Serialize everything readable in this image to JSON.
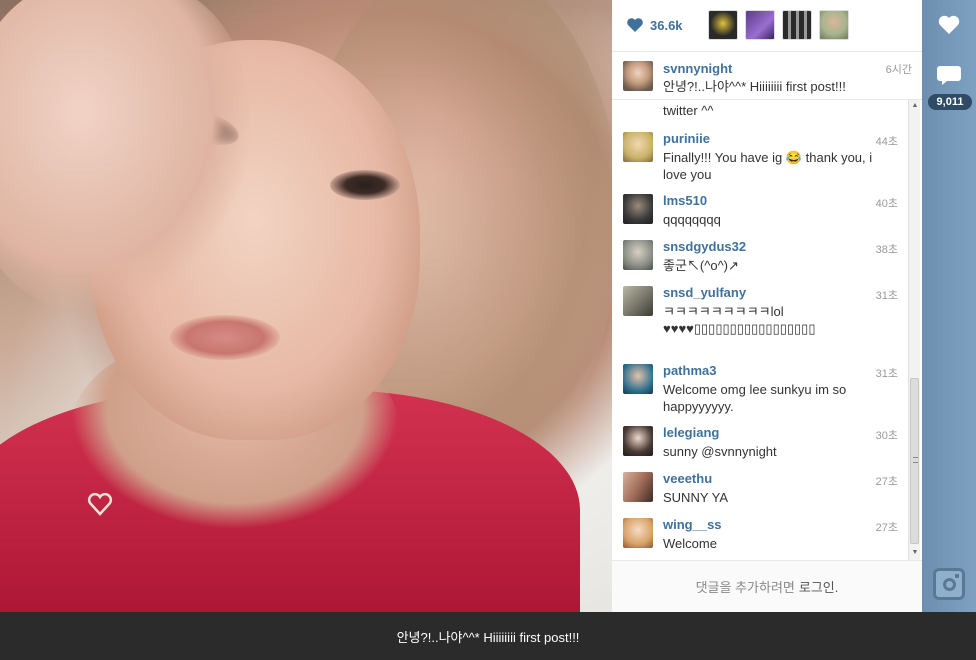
{
  "likes": {
    "count": "36.6k",
    "icon": "heart-icon"
  },
  "likers": [
    "liker-1",
    "liker-2",
    "liker-3",
    "liker-4"
  ],
  "caption": {
    "username": "svnnynight",
    "text": "안녕?!..나야^^* Hiiiiiiii first post!!!",
    "time": "6시간"
  },
  "comments": {
    "partial_text": "twitter ^^",
    "items": [
      {
        "username": "puriniie",
        "text": "Finally!!! You have ig 😂 thank you, i love you",
        "time": "44초",
        "avatar_color": "#c9b26a"
      },
      {
        "username": "lms510",
        "text": "qqqqqqqq",
        "time": "40초",
        "avatar_color": "#3a3a3a"
      },
      {
        "username": "snsdgydus32",
        "text": "좋군↖(^o^)↗",
        "time": "38초",
        "avatar_color": "#8a8f86"
      },
      {
        "username": "snsd_yulfany",
        "text": "ㅋㅋㅋㅋㅋㅋㅋㅋㅋlol ♥♥♥♥▯▯▯▯▯▯▯▯▯▯▯▯▯▯▯▯▯",
        "time": "31초",
        "avatar_color": "#7c7b6e"
      },
      {
        "username": "pathma3",
        "text": "Welcome omg lee sunkyu im so happyyyyyy.",
        "time": "31초",
        "avatar_color": "#2f6f8c"
      },
      {
        "username": "lelegiang",
        "text": "sunny @svnnynight",
        "time": "30초",
        "avatar_color": "#4a3b35"
      },
      {
        "username": "veeethu",
        "text": "SUNNY YA",
        "time": "27초",
        "avatar_color": "#a26e5a"
      },
      {
        "username": "wing__ss",
        "text": "Welcome",
        "time": "27초",
        "avatar_color": "#d9a36a"
      }
    ]
  },
  "login": {
    "prefix": "댓글을 추가하려면",
    "link": "로그인."
  },
  "side": {
    "comment_count": "9,011",
    "like_icon": "heart-icon",
    "comment_icon": "speech-bubble-icon",
    "logo_icon": "instagram-camera-icon"
  },
  "bottom_caption": "안녕?!..나야^^* Hiiiiiiii first post!!!",
  "colors": {
    "accent": "#3f729b",
    "strip": "#7fa1c1",
    "badge": "#2e4b68"
  }
}
